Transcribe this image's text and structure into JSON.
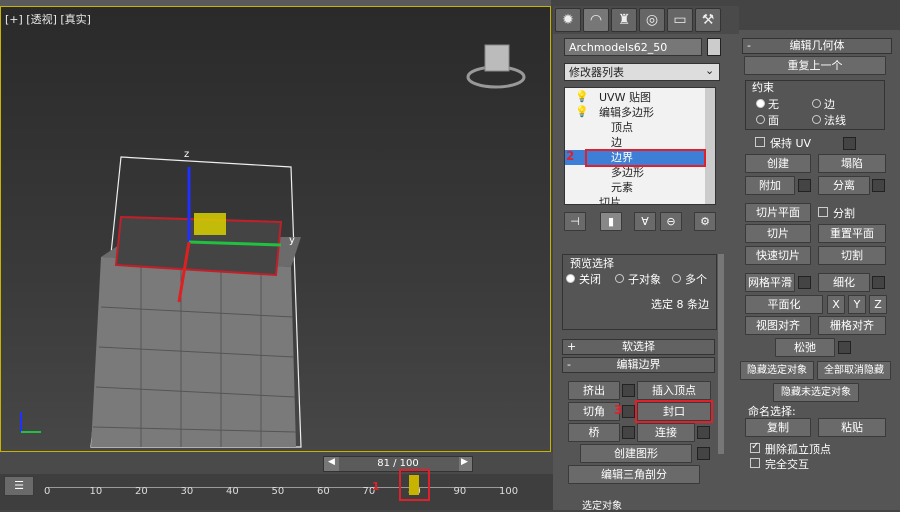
{
  "viewport": {
    "label": "[+] [透视] [真实]"
  },
  "object_name": "Archmodels62_50",
  "modifier_list": "修改器列表",
  "stack": [
    {
      "label": "UVW 贴图",
      "level": 0
    },
    {
      "label": "编辑多边形",
      "level": 0
    },
    {
      "label": "顶点",
      "level": 1
    },
    {
      "label": "边",
      "level": 1
    },
    {
      "label": "边界",
      "level": 1,
      "selected": true
    },
    {
      "label": "多边形",
      "level": 1
    },
    {
      "label": "元素",
      "level": 1
    },
    {
      "label": "切片",
      "level": 0
    }
  ],
  "annotations": {
    "n1": "1",
    "n2": "2",
    "n3": "3"
  },
  "preview": {
    "title": "预览选择",
    "off": "关闭",
    "sub": "子对象",
    "multi": "多个",
    "status": "选定 8 条边"
  },
  "soft_select": "软选择",
  "edit_border": {
    "title": "编辑边界",
    "extrude": "挤出",
    "insert_vertex": "插入顶点",
    "chamfer": "切角",
    "cap": "封口",
    "bridge": "桥",
    "connect": "连接",
    "create_shape": "创建图形",
    "edit_tri": "编辑三角剖分"
  },
  "geom": {
    "title": "编辑几何体",
    "repeat": "重复上一个",
    "constraint": "约束",
    "none": "无",
    "edge": "边",
    "face": "面",
    "normal": "法线",
    "keep_uv": "保持 UV",
    "create": "创建",
    "collapse": "塌陷",
    "attach": "附加",
    "detach": "分离",
    "slice_plane": "切片平面",
    "split": "分割",
    "slice": "切片",
    "reset_plane": "重置平面",
    "quickslice": "快速切片",
    "cut": "切割",
    "msmooth": "网格平滑",
    "refine": "细化",
    "planarize": "平面化",
    "x": "X",
    "y": "Y",
    "z": "Z",
    "view_align": "视图对齐",
    "grid_align": "栅格对齐",
    "relax": "松弛",
    "hide_sel": "隐藏选定对象",
    "unhide_all": "全部取消隐藏",
    "hide_unsel": "隐藏未选定对象",
    "named_sel": "命名选择:",
    "copy": "复制",
    "paste": "粘贴",
    "delete_iso": "删除孤立顶点",
    "full_int": "完全交互"
  },
  "timeline": {
    "frame": "81 / 100",
    "ticks": [
      "0",
      "10",
      "20",
      "30",
      "40",
      "50",
      "60",
      "70",
      "80",
      "90",
      "100"
    ],
    "current": "81"
  },
  "status": {
    "select_obj": "选定对象"
  },
  "colors": {
    "accent": "#3d7fd6",
    "red": "#e0202a",
    "viewport_border": "#c8b400"
  }
}
